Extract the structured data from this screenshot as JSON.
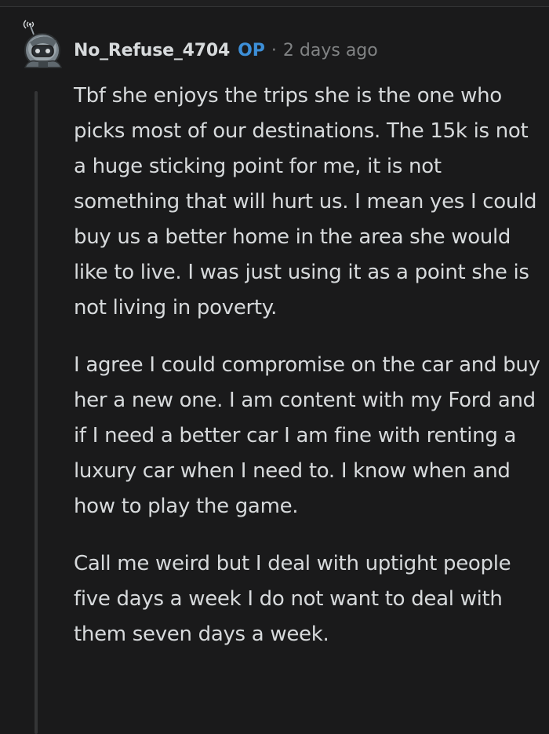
{
  "comment": {
    "author": "No_Refuse_4704",
    "op_badge": "OP",
    "separator": "·",
    "timestamp": "2 days ago",
    "avatar_icon": "snoo-robot-avatar-icon",
    "paragraphs": [
      "Tbf she enjoys the trips she is the one who picks most of our destinations. The 15k is not a huge sticking point for me, it is not something that will hurt us. I mean yes I could buy us a better home in the area she would like to live. I was just using it as a point she is not living in poverty.",
      "I agree I could compromise on the car and buy her a new one. I am content with my Ford and if I need a better car I am fine with renting a luxury car when I need to. I know when and how to play the game.",
      "Call me weird but I deal with uptight people five days a week I do not want to deal with them seven days a week."
    ]
  },
  "colors": {
    "background": "#1a1a1b",
    "text": "#d7dadc",
    "muted": "#818384",
    "op_accent": "#3d8fd8",
    "thread_line": "#343536"
  }
}
